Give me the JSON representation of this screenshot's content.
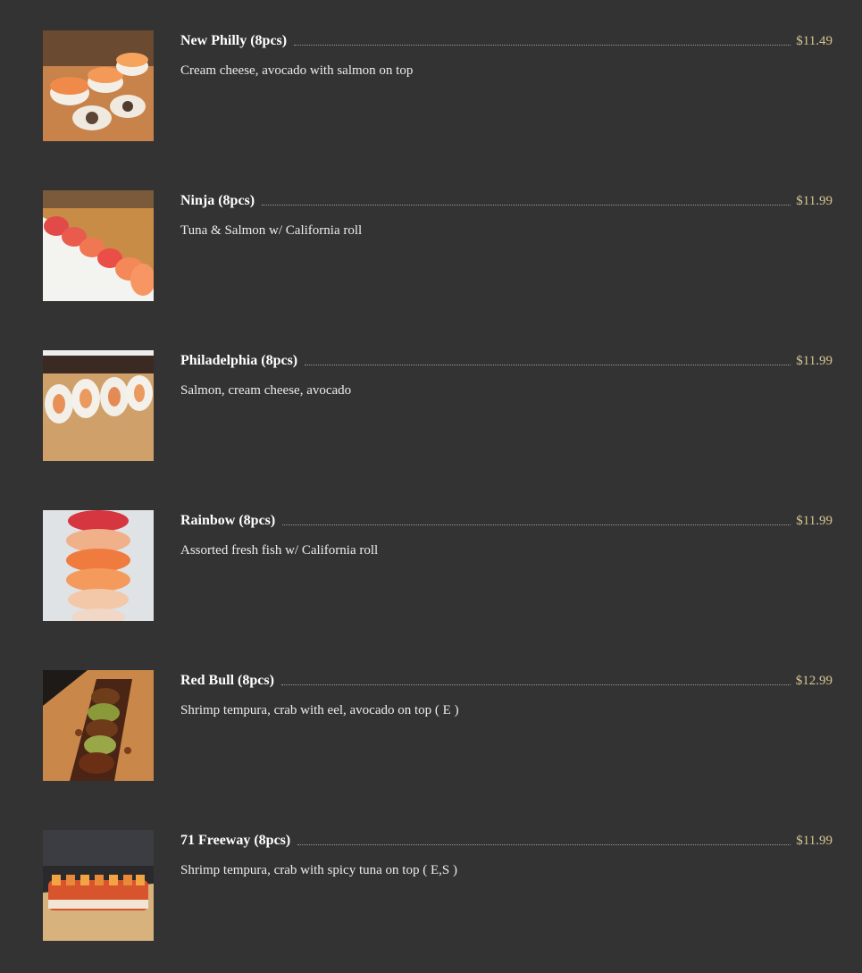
{
  "items": [
    {
      "name": "New Philly (8pcs)",
      "price": "$11.49",
      "description": "Cream cheese, avocado with salmon on top",
      "image": "new-philly-roll-photo"
    },
    {
      "name": "Ninja (8pcs)",
      "price": "$11.99",
      "description": "Tuna & Salmon w/ California roll",
      "image": "ninja-roll-photo"
    },
    {
      "name": "Philadelphia (8pcs)",
      "price": "$11.99",
      "description": "Salmon, cream cheese, avocado",
      "image": "philadelphia-roll-photo"
    },
    {
      "name": "Rainbow (8pcs)",
      "price": "$11.99",
      "description": "Assorted fresh fish w/ California roll",
      "image": "rainbow-roll-photo"
    },
    {
      "name": "Red Bull (8pcs)",
      "price": "$12.99",
      "description": "Shrimp tempura, crab with eel, avocado on top ( E )",
      "image": "red-bull-roll-photo"
    },
    {
      "name": "71 Freeway (8pcs)",
      "price": "$11.99",
      "description": "Shrimp tempura, crab with spicy tuna on top ( E,S )",
      "image": "71-freeway-roll-photo"
    }
  ],
  "colors": {
    "background": "#333333",
    "name_text": "#ffffff",
    "price_text": "#d8c690",
    "description_text": "#ececec"
  }
}
